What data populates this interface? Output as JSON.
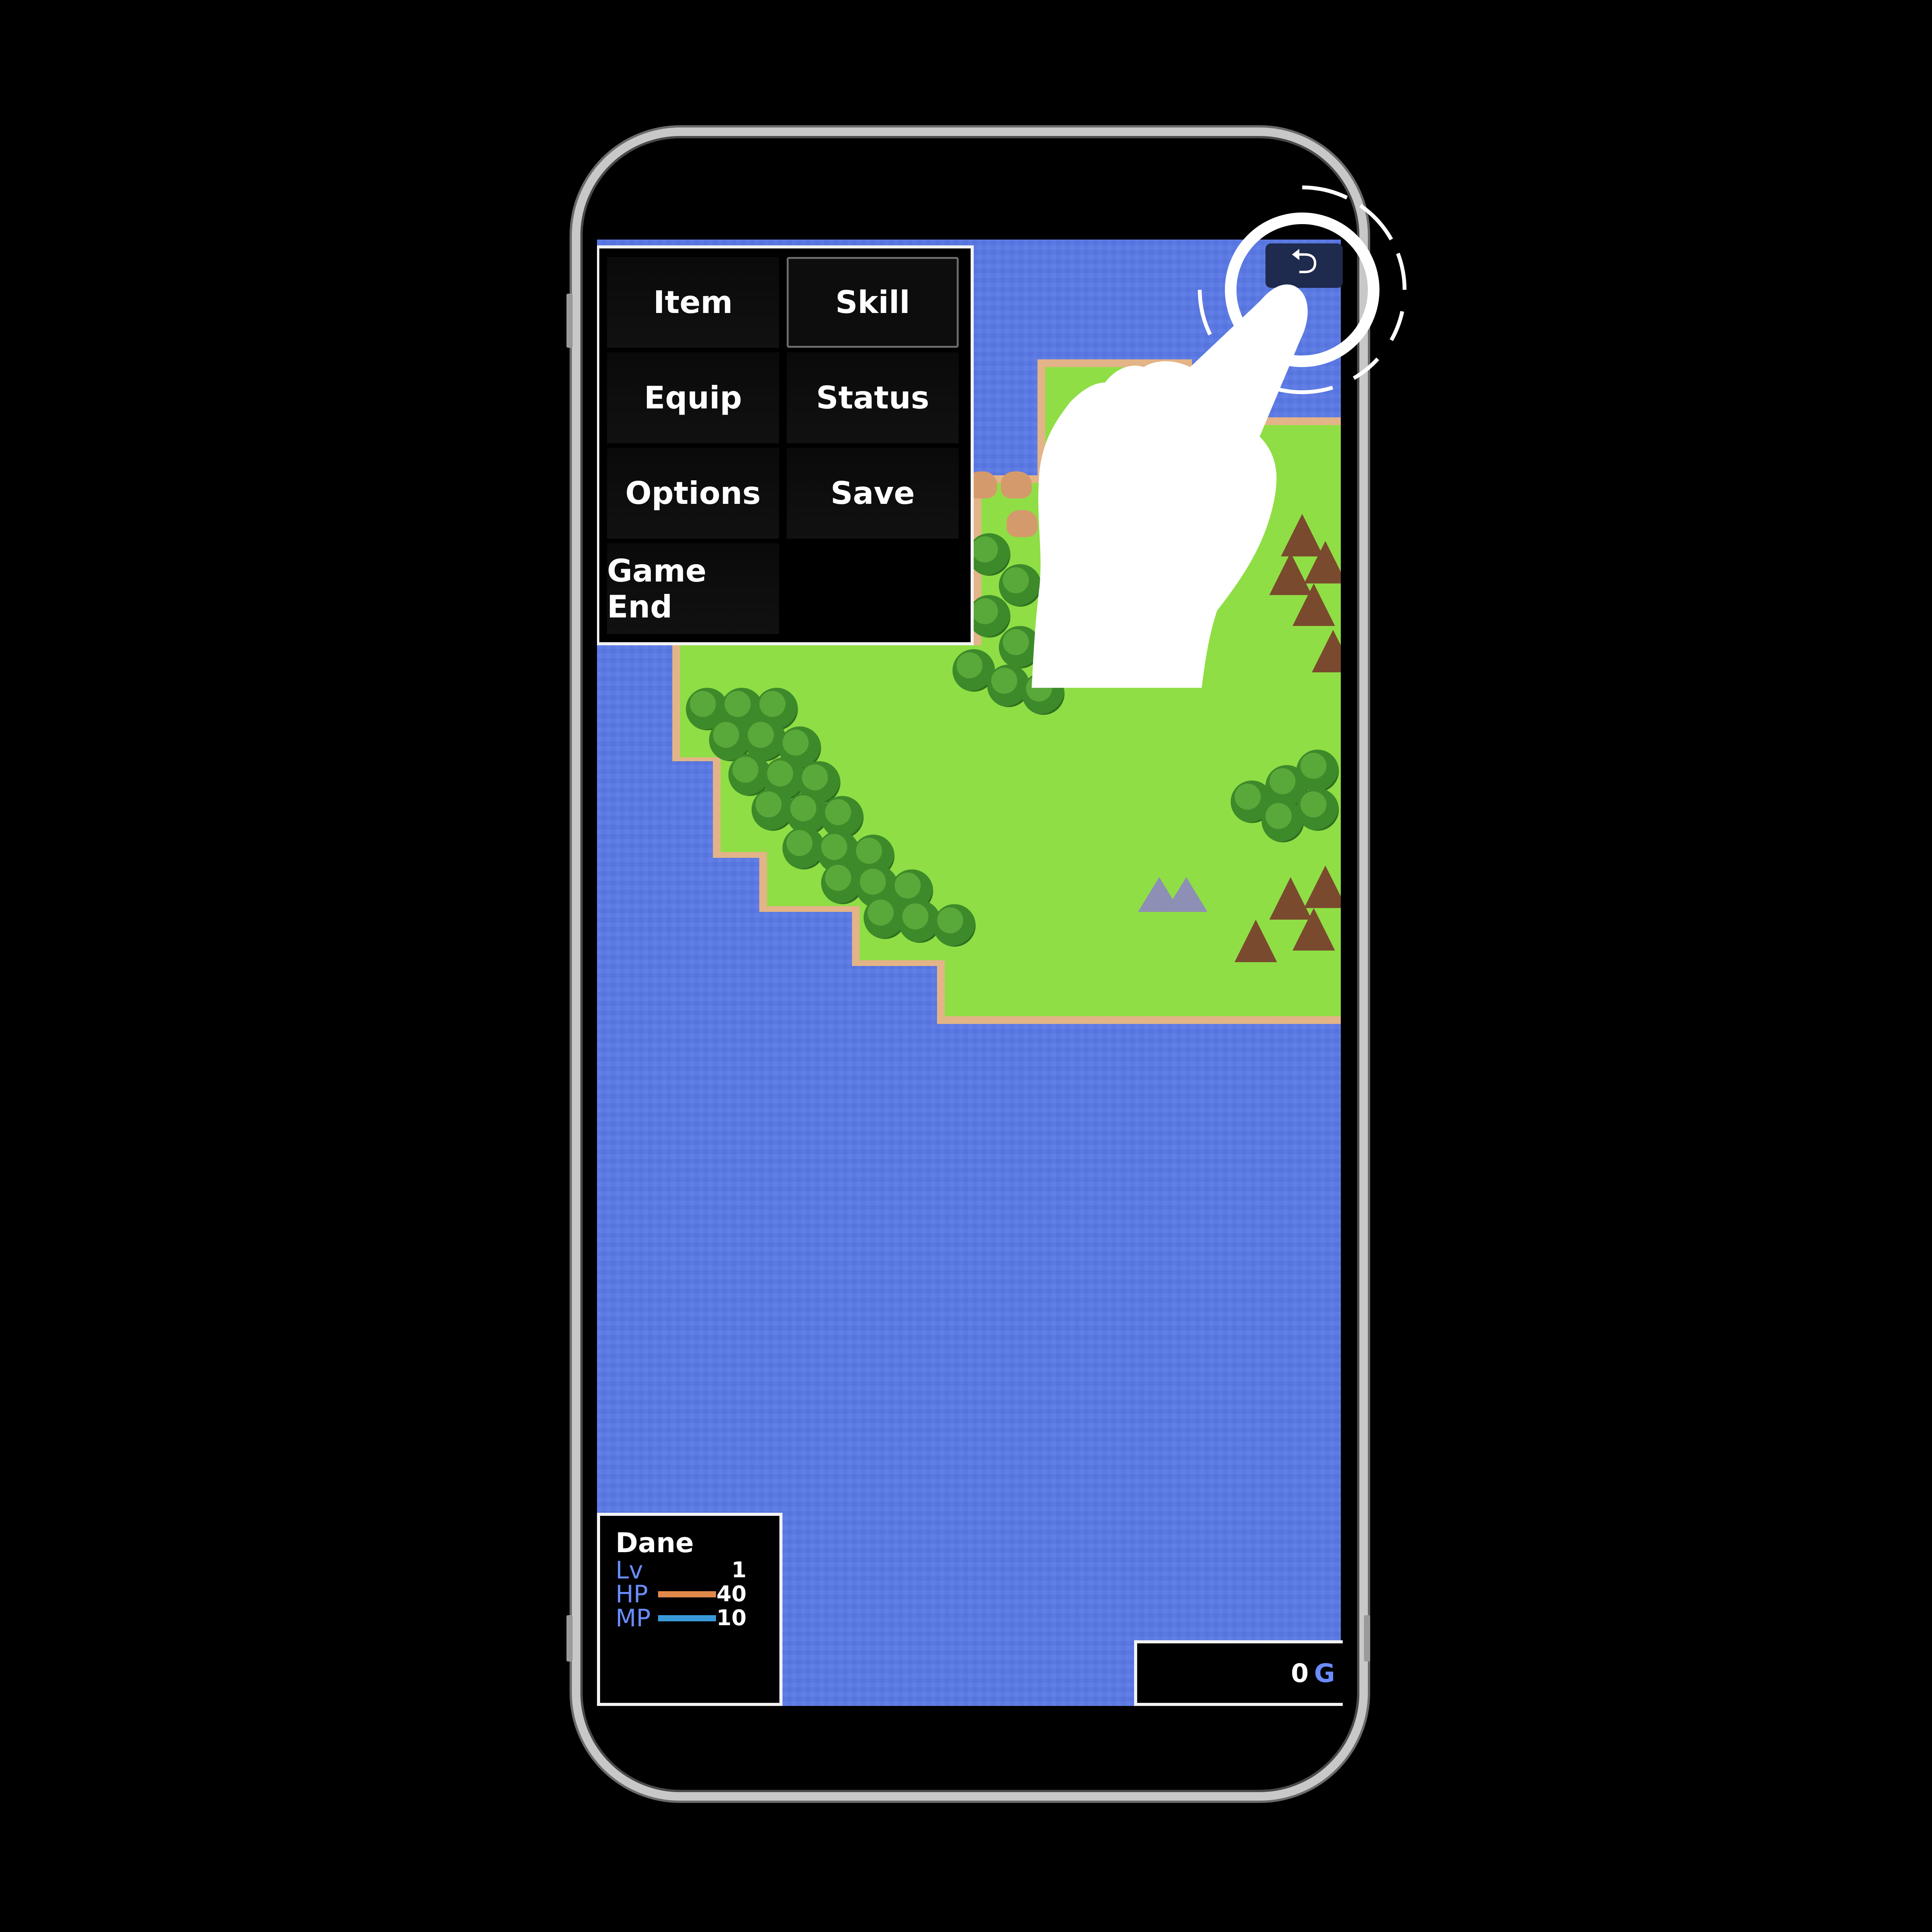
{
  "menu": {
    "items": [
      {
        "label": "Item",
        "selected": false
      },
      {
        "label": "Skill",
        "selected": true
      },
      {
        "label": "Equip",
        "selected": false
      },
      {
        "label": "Status",
        "selected": false
      },
      {
        "label": "Options",
        "selected": false
      },
      {
        "label": "Save",
        "selected": false
      },
      {
        "label": "Game End",
        "selected": false
      }
    ]
  },
  "back_button": {
    "icon": "back-arrow-icon",
    "glyph": "⮌"
  },
  "actor": {
    "name": "Dane",
    "level_label": "Lv",
    "level": "1",
    "hp_label": "HP",
    "hp": "40",
    "hp_fill": 1.0,
    "mp_label": "MP",
    "mp": "10",
    "mp_fill": 1.0
  },
  "gold": {
    "amount": "0",
    "unit": "G"
  },
  "colors": {
    "sea": "#5a78e6",
    "grass": "#8fde45",
    "shore": "#e3b487",
    "hp_gauge": "#e0894a",
    "mp_gauge": "#3a9ad9",
    "system_text": "#6a8cff"
  },
  "gesture": {
    "icon": "tap-hand-icon"
  }
}
